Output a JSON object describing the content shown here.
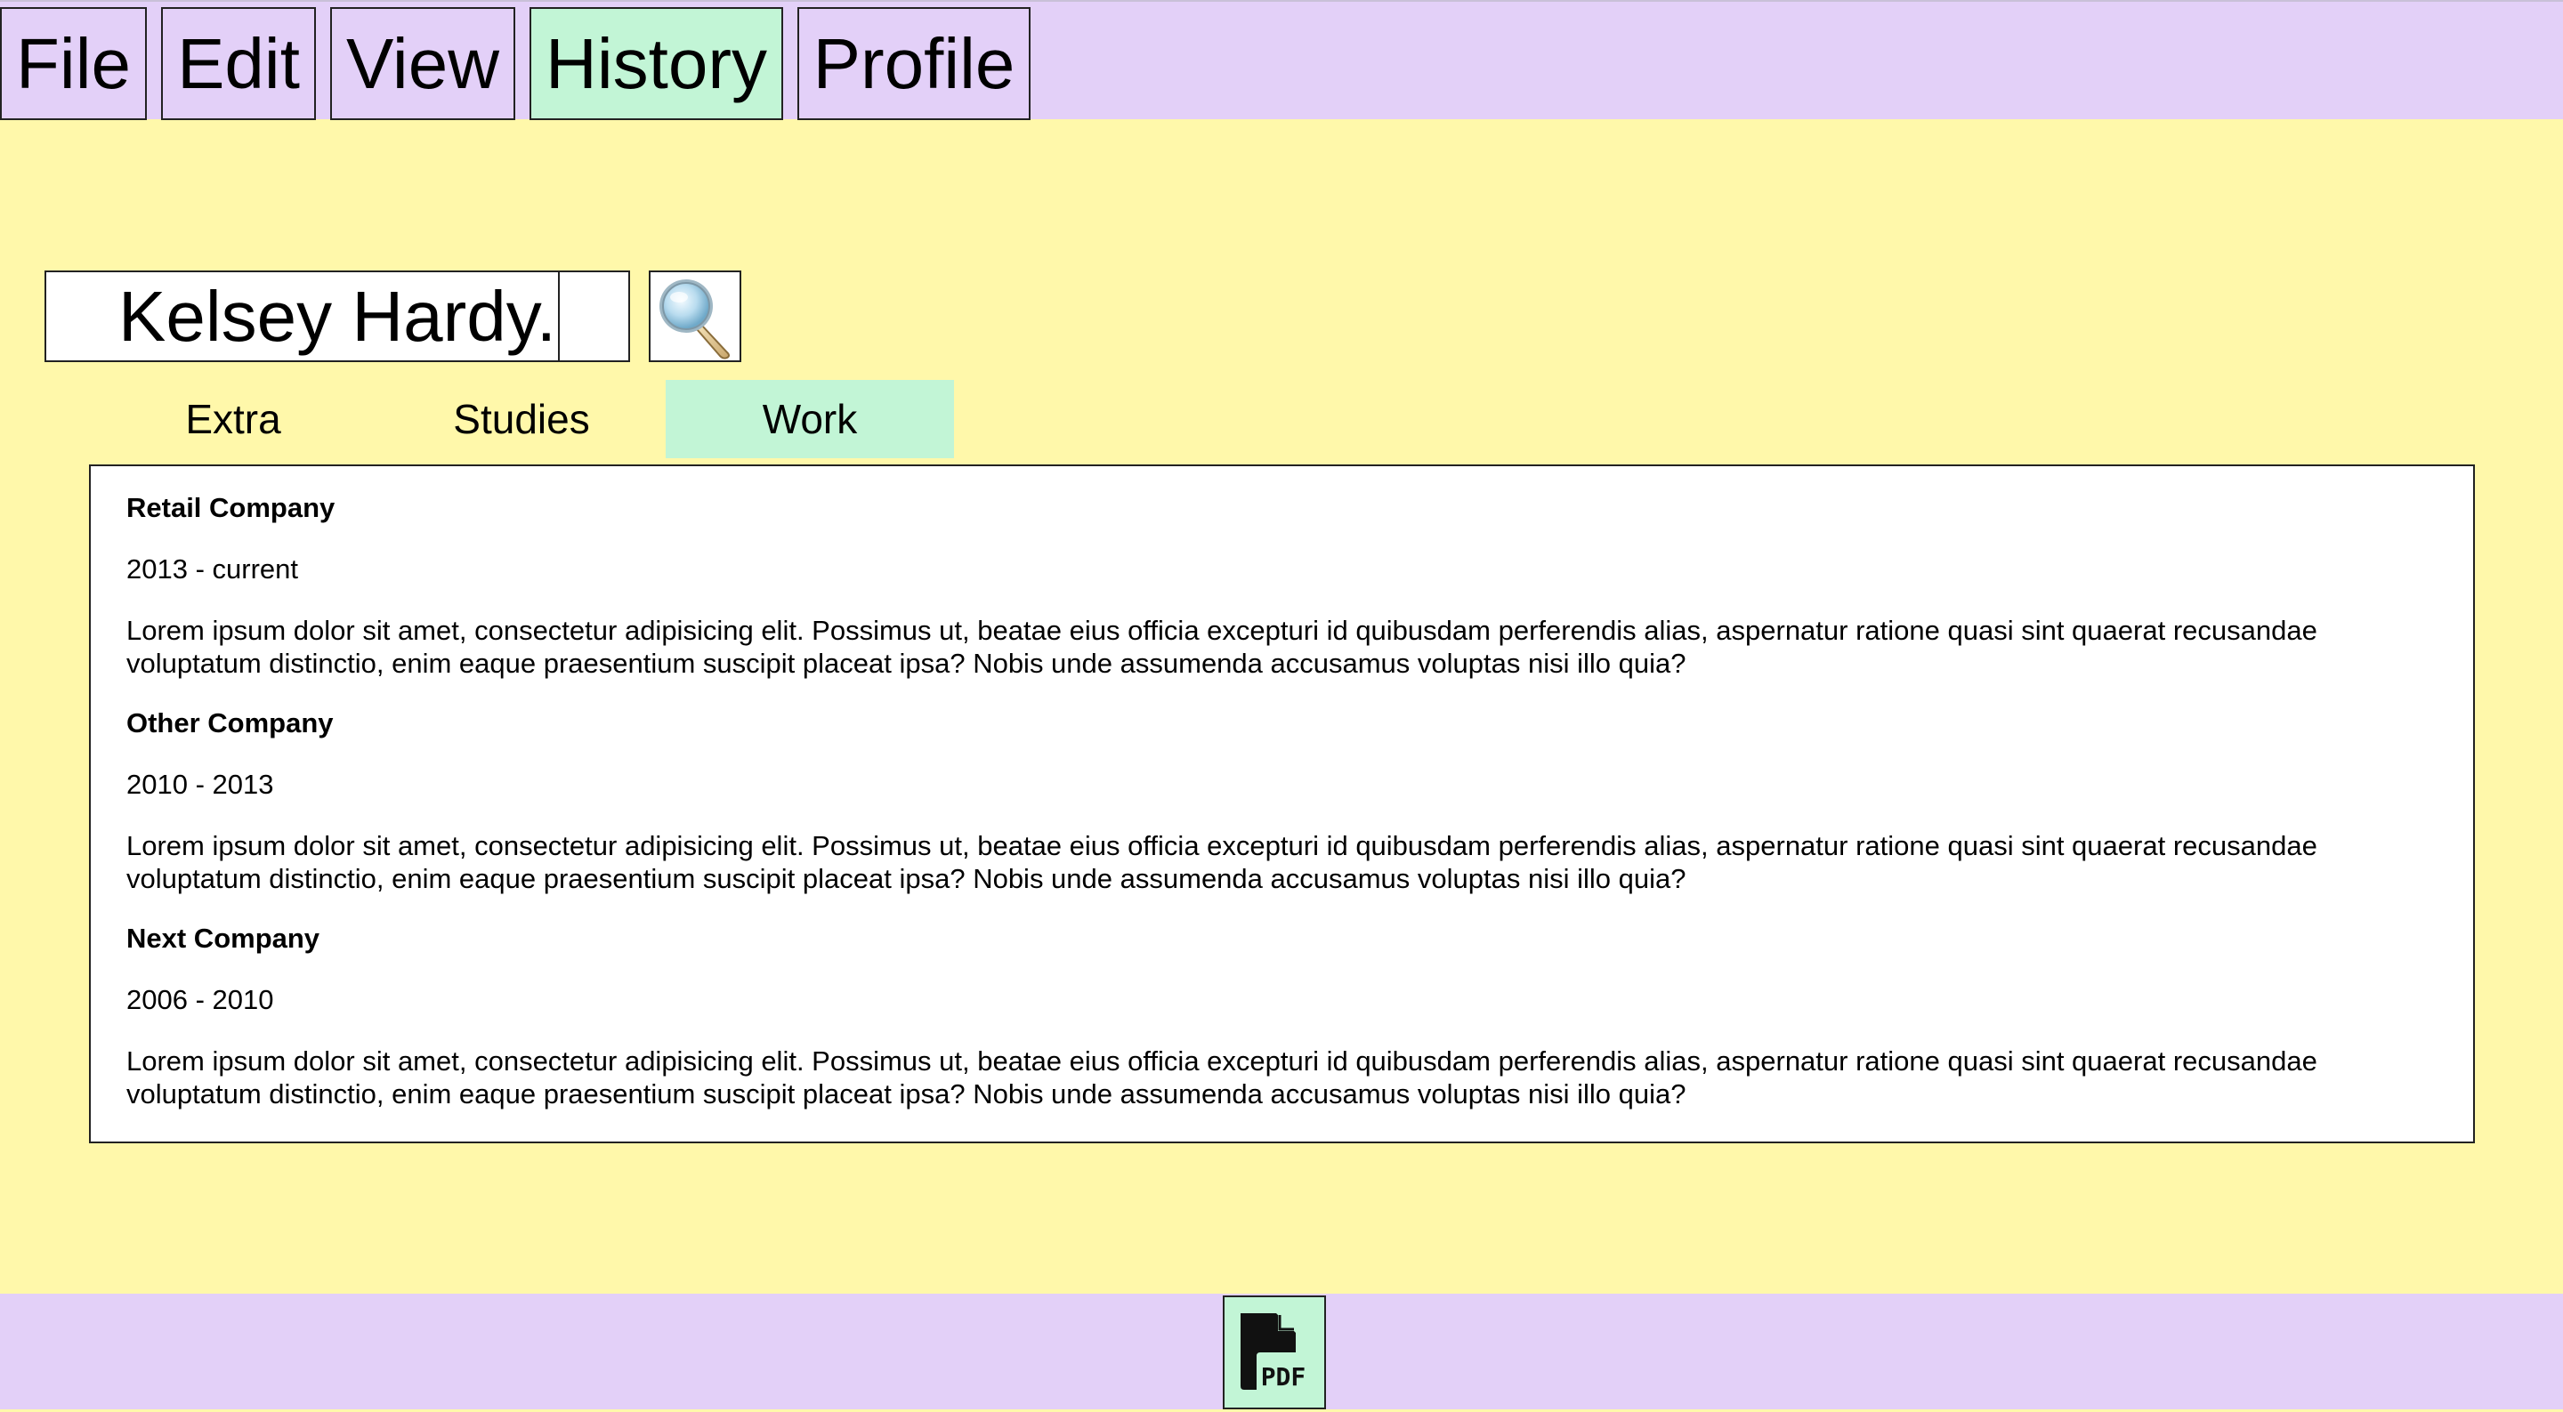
{
  "menu": {
    "items": [
      {
        "label": "File"
      },
      {
        "label": "Edit"
      },
      {
        "label": "View"
      },
      {
        "label": "History"
      },
      {
        "label": "Profile"
      }
    ],
    "active": "History"
  },
  "search": {
    "value": "Kelsey Hardy."
  },
  "tabs": {
    "items": [
      {
        "label": "Extra"
      },
      {
        "label": "Studies"
      },
      {
        "label": "Work"
      }
    ],
    "active": "Work"
  },
  "work": {
    "entries": [
      {
        "company": "Retail Company",
        "period": "2013 - current",
        "description": "Lorem ipsum dolor sit amet, consectetur adipisicing elit. Possimus ut, beatae eius officia excepturi id quibusdam perferendis alias, aspernatur ratione quasi sint quaerat recusandae voluptatum distinctio, enim eaque praesentium suscipit placeat ipsa? Nobis unde assumenda accusamus voluptas nisi illo quia?"
      },
      {
        "company": "Other Company",
        "period": "2010 - 2013",
        "description": "Lorem ipsum dolor sit amet, consectetur adipisicing elit. Possimus ut, beatae eius officia excepturi id quibusdam perferendis alias, aspernatur ratione quasi sint quaerat recusandae voluptatum distinctio, enim eaque praesentium suscipit placeat ipsa? Nobis unde assumenda accusamus voluptas nisi illo quia?"
      },
      {
        "company": "Next Company",
        "period": "2006 - 2010",
        "description": "Lorem ipsum dolor sit amet, consectetur adipisicing elit. Possimus ut, beatae eius officia excepturi id quibusdam perferendis alias, aspernatur ratione quasi sint quaerat recusandae voluptatum distinctio, enim eaque praesentium suscipit placeat ipsa? Nobis unde assumenda accusamus voluptas nisi illo quia?"
      }
    ]
  },
  "footer": {
    "pdf_icon_text": "PDF"
  },
  "icons": {
    "search": "magnifier-icon",
    "pdf": "pdf-file-icon"
  },
  "colors": {
    "background": "#fff8aa",
    "bars": "#e3d0f8",
    "active": "#c2f5d6"
  }
}
